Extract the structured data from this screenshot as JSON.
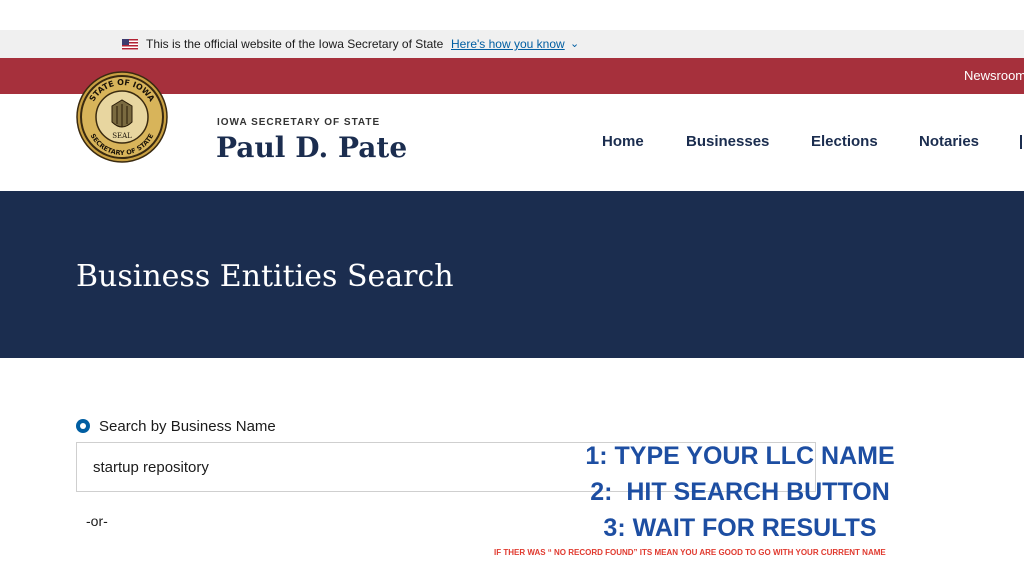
{
  "official_banner": {
    "text": "This is the official website of the Iowa Secretary of State",
    "link_text": "Here's how you know",
    "flag_icon": "us-flag-icon",
    "chevron_icon": "chevron-down-icon"
  },
  "utility_bar": {
    "newsroom_label": "Newsroom"
  },
  "header": {
    "seal_icon": "state-seal-icon",
    "seal_top_text": "STATE OF IOWA",
    "seal_bottom_text": "SECRETARY OF STATE",
    "seal_center_text": "SEAL",
    "agency": "IOWA SECRETARY OF STATE",
    "name": "Paul D. Pate",
    "nav": [
      "Home",
      "Businesses",
      "Elections",
      "Notaries"
    ]
  },
  "hero": {
    "title": "Business Entities Search"
  },
  "search": {
    "radio_label": "Search by Business Name",
    "input_value": "startup repository",
    "or_text": "-or-"
  },
  "instructions": {
    "steps": [
      "1: TYPE YOUR LLC NAME",
      "2:  HIT SEARCH BUTTON",
      "3: WAIT FOR RESULTS"
    ],
    "note": "IF THER WAS “ NO RECORD FOUND” ITS MEAN YOU ARE GOOD TO GO WITH YOUR CURRENT NAME"
  },
  "colors": {
    "navy": "#1b2d4f",
    "red_bar": "#a6303c",
    "link_blue": "#005ea2",
    "step_blue": "#1d4ea2",
    "note_red": "#e03a2f"
  }
}
